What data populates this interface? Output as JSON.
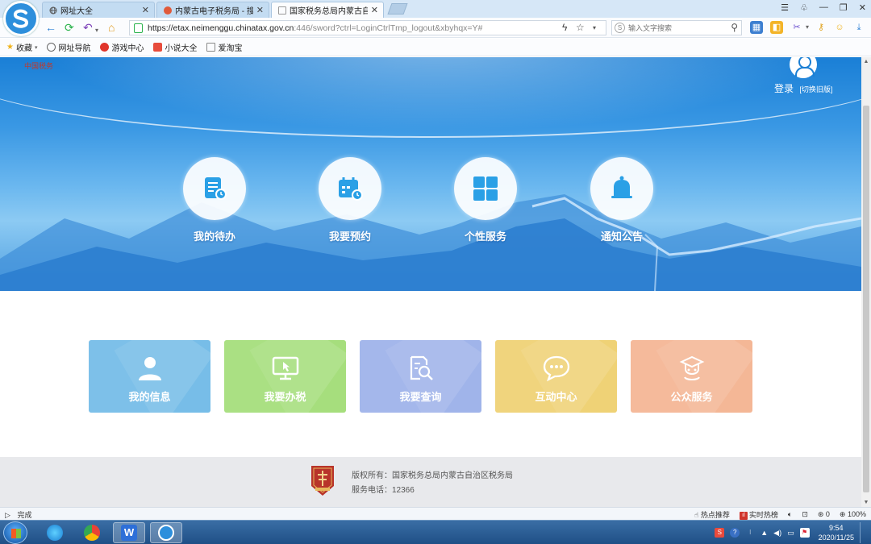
{
  "browser": {
    "tabs": [
      {
        "title": "网址大全",
        "active": false
      },
      {
        "title": "内蒙古电子税务局 - 搜狗",
        "active": false
      },
      {
        "title": "国家税务总局内蒙古自治",
        "active": true
      }
    ],
    "url_host": "https://etax.neimenggu.chinatax.gov.cn",
    "url_rest": ":446/sword?ctrl=LoginCtrlTmp_logout&xbyhqx=Y#",
    "search_placeholder": "输入文字搜索",
    "bookmarks": [
      {
        "label": "收藏",
        "icon": "star-icon"
      },
      {
        "label": "网址导航",
        "icon": "globe-icon"
      },
      {
        "label": "游戏中心",
        "icon": "game-icon"
      },
      {
        "label": "小说大全",
        "icon": "book-icon"
      },
      {
        "label": "爱淘宝",
        "icon": "page-icon"
      }
    ],
    "status_text": "完成",
    "status_right": {
      "hot_recommend": "热点推荐",
      "live_hot": "实时热榜",
      "count": "0",
      "zoom": "100%"
    }
  },
  "header": {
    "logo_text": "中国税务",
    "login_label": "登录",
    "old_version_label": "[切换旧版]"
  },
  "quick_nav": [
    {
      "label": "我的待办",
      "icon": "todo-list-icon"
    },
    {
      "label": "我要预约",
      "icon": "calendar-icon"
    },
    {
      "label": "个性服务",
      "icon": "grid-icon"
    },
    {
      "label": "通知公告",
      "icon": "bell-icon"
    }
  ],
  "cards": [
    {
      "label": "我的信息",
      "icon": "user-icon",
      "color": "#6cb8e6"
    },
    {
      "label": "我要办税",
      "icon": "monitor-icon",
      "color": "#9fdc72"
    },
    {
      "label": "我要查询",
      "icon": "search-doc-icon",
      "color": "#98aee9"
    },
    {
      "label": "互动中心",
      "icon": "chat-icon",
      "color": "#eecf6b"
    },
    {
      "label": "公众服务",
      "icon": "service-icon",
      "color": "#f4b18e"
    }
  ],
  "footer": {
    "copyright": "版权所有：国家税务总局内蒙古自治区税务局",
    "phone": "服务电话：12366"
  },
  "taskbar": {
    "time": "9:54",
    "date": "2020/11/25"
  },
  "colors": {
    "banner_blue": "#1a7fd6",
    "footer_bg": "#e8e9ec",
    "taskbar": "#1f4f86"
  }
}
